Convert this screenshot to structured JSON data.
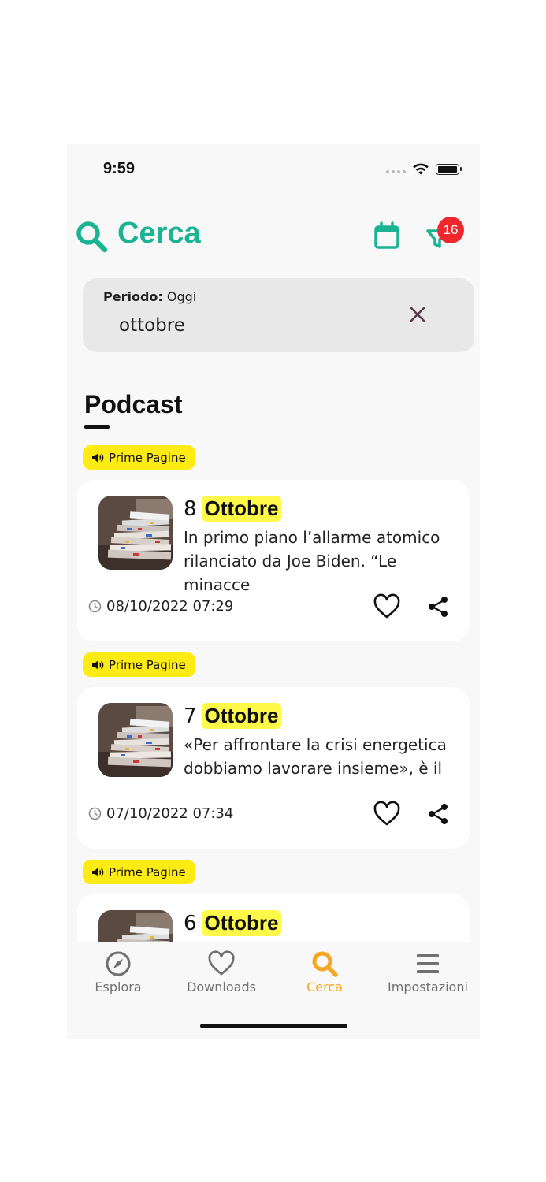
{
  "status": {
    "time": "9:59"
  },
  "header": {
    "title": "Cerca",
    "filter_count": "16"
  },
  "search": {
    "period_label": "Periodo:",
    "period_value": "Oggi",
    "query": "ottobre"
  },
  "section": {
    "title": "Podcast"
  },
  "colors": {
    "accent": "#1ab394",
    "active_nav": "#f5a623",
    "tag_bg": "#ffeb14",
    "highlight": "#fff94a",
    "badge": "#f0282d"
  },
  "items": [
    {
      "tag": "Prime Pagine",
      "day": "8",
      "month": "Ottobre",
      "excerpt": "In primo piano l’allarme atomico rilanciato da Joe Biden. “Le minacce",
      "date": "08/10/2022 07:29"
    },
    {
      "tag": "Prime Pagine",
      "day": "7",
      "month": "Ottobre",
      "excerpt": "«Per affrontare la crisi energetica dobbiamo lavorare insieme», è il",
      "date": "07/10/2022 07:34"
    },
    {
      "tag": "Prime Pagine",
      "day": "6",
      "month": "Ottobre",
      "excerpt": "",
      "date": ""
    }
  ],
  "nav": [
    {
      "label": "Esplora",
      "icon": "compass-icon"
    },
    {
      "label": "Downloads",
      "icon": "heart-icon"
    },
    {
      "label": "Cerca",
      "icon": "search-icon",
      "active": true
    },
    {
      "label": "Impostazioni",
      "icon": "menu-icon"
    }
  ]
}
